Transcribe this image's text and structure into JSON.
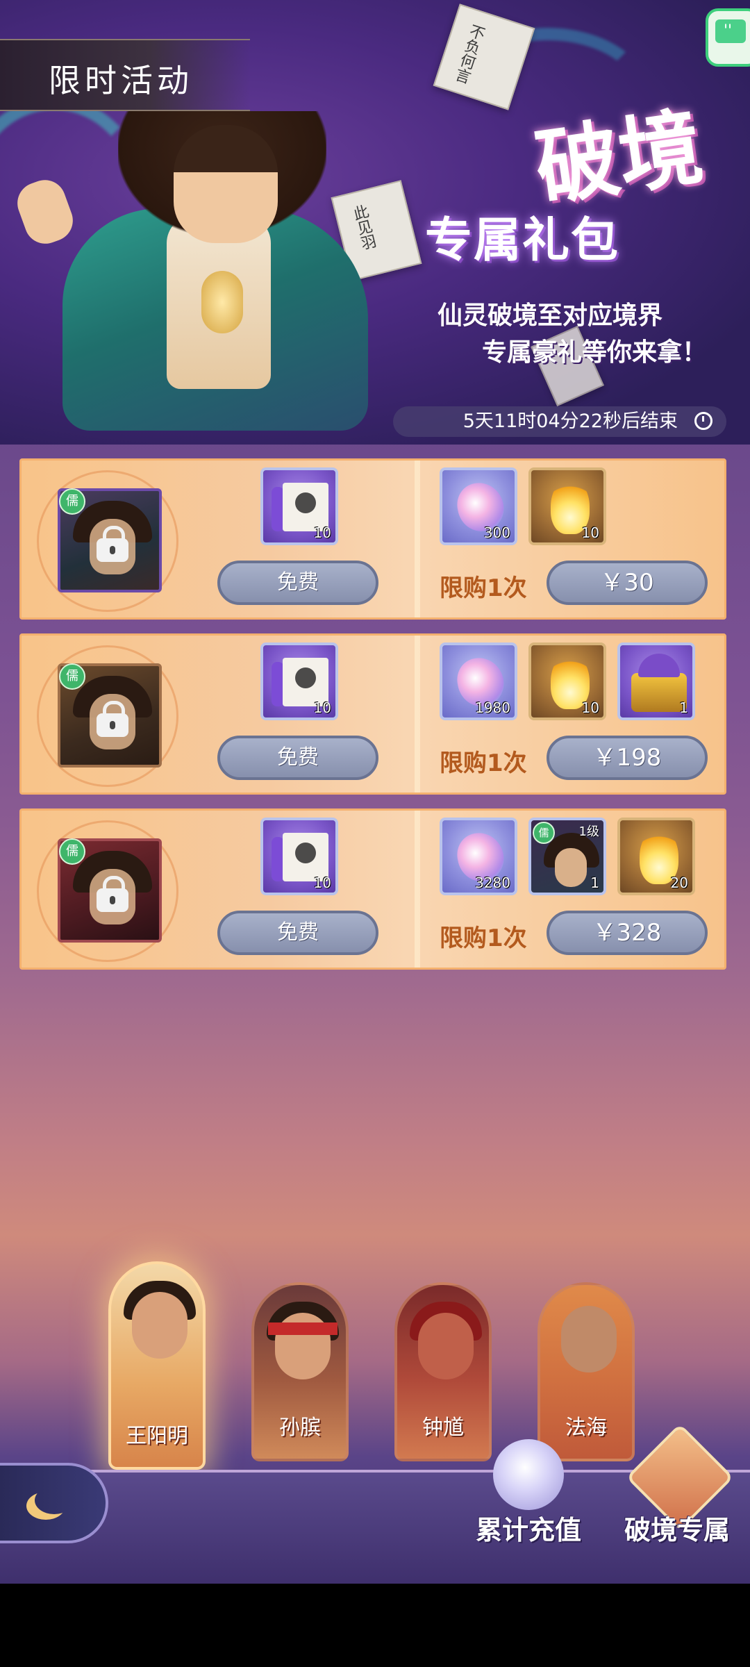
{
  "header": {
    "activity_tab": "限时活动",
    "title_main": "破境",
    "title_sub": "专属礼包",
    "tagline_1": "仙灵破境至对应境界",
    "tagline_2": "专属豪礼等你来拿！",
    "timer": "5天11时04分22秒后结束",
    "banner_paper_text": [
      "不负何言",
      "此见羽"
    ]
  },
  "tiers": [
    {
      "class_badge": "儒",
      "free_item": {
        "icon": "scroll-icon",
        "qty": "10"
      },
      "free_label": "免费",
      "paid_items": [
        {
          "icon": "crystal-icon",
          "qty": "300"
        },
        {
          "icon": "flame-icon",
          "qty": "10"
        }
      ],
      "limit_label": "限购1次",
      "price": "￥30"
    },
    {
      "class_badge": "儒",
      "free_item": {
        "icon": "scroll-icon",
        "qty": "10"
      },
      "free_label": "免费",
      "paid_items": [
        {
          "icon": "crystal-icon",
          "qty": "1980"
        },
        {
          "icon": "flame-icon",
          "qty": "10"
        },
        {
          "icon": "treasure-chest-icon",
          "qty": "1"
        }
      ],
      "limit_label": "限购1次",
      "price": "￥198"
    },
    {
      "class_badge": "儒",
      "free_item": {
        "icon": "scroll-icon",
        "qty": "10"
      },
      "free_label": "免费",
      "paid_items": [
        {
          "icon": "crystal-icon",
          "qty": "3280"
        },
        {
          "icon": "hero-portrait-icon",
          "qty": "1",
          "level": "1级",
          "badge": "儒"
        },
        {
          "icon": "flame-icon",
          "qty": "20"
        }
      ],
      "limit_label": "限购1次",
      "price": "￥328"
    }
  ],
  "heroes": [
    {
      "name": "王阳明",
      "selected": true
    },
    {
      "name": "孙膑",
      "selected": false
    },
    {
      "name": "钟馗",
      "selected": false
    },
    {
      "name": "法海",
      "selected": false
    }
  ],
  "bottom_nav": {
    "cumulative_recharge": "累计充值",
    "breakthrough_exclusive": "破境专属"
  },
  "colors": {
    "row_bg": "#f8c489",
    "price_button": "#8790ad",
    "limit_text": "#b35a1e",
    "class_badge": "#3fb56a"
  }
}
